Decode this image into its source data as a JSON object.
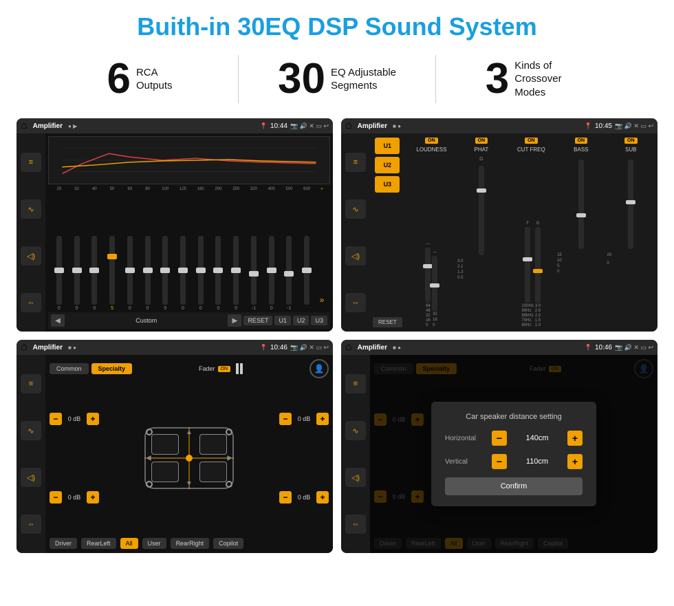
{
  "page": {
    "title": "Buith-in 30EQ DSP Sound System",
    "stats": [
      {
        "number": "6",
        "label_line1": "RCA",
        "label_line2": "Outputs"
      },
      {
        "number": "30",
        "label_line1": "EQ Adjustable",
        "label_line2": "Segments"
      },
      {
        "number": "3",
        "label_line1": "Kinds of",
        "label_line2": "Crossover Modes"
      }
    ]
  },
  "screen1": {
    "status_bar": {
      "app": "Amplifier",
      "time": "10:44"
    },
    "eq_bands": [
      "25",
      "32",
      "40",
      "50",
      "63",
      "80",
      "100",
      "125",
      "160",
      "200",
      "250",
      "320",
      "400",
      "500",
      "630"
    ],
    "eq_values": [
      "0",
      "0",
      "0",
      "5",
      "0",
      "0",
      "0",
      "0",
      "0",
      "0",
      "0",
      "-1",
      "0",
      "-1"
    ],
    "bottom_label": "Custom",
    "modes": [
      "RESET",
      "U1",
      "U2",
      "U3"
    ]
  },
  "screen2": {
    "status_bar": {
      "app": "Amplifier",
      "time": "10:45"
    },
    "presets": [
      "U1",
      "U2",
      "U3"
    ],
    "columns": [
      "LOUDNESS",
      "PHAT",
      "CUT FREQ",
      "BASS",
      "SUB"
    ],
    "reset_label": "RESET"
  },
  "screen3": {
    "status_bar": {
      "app": "Amplifier",
      "time": "10:46"
    },
    "tabs": [
      "Common",
      "Specialty"
    ],
    "active_tab": "Specialty",
    "fader_label": "Fader",
    "on_label": "ON",
    "db_values": [
      "0 dB",
      "0 dB",
      "0 dB",
      "0 dB"
    ],
    "zone_buttons": [
      "Driver",
      "RearLeft",
      "All",
      "User",
      "RearRight",
      "Copilot"
    ]
  },
  "screen4": {
    "status_bar": {
      "app": "Amplifier",
      "time": "10:46"
    },
    "tabs": [
      "Common",
      "Specialty"
    ],
    "active_tab": "Specialty",
    "dialog": {
      "title": "Car speaker distance setting",
      "horizontal_label": "Horizontal",
      "horizontal_value": "140cm",
      "vertical_label": "Vertical",
      "vertical_value": "110cm",
      "confirm_label": "Confirm"
    },
    "db_values": [
      "0 dB",
      "0 dB"
    ],
    "zone_buttons": [
      "Driver",
      "RearLeft",
      "All",
      "User",
      "RearRight",
      "Copilot"
    ]
  },
  "icons": {
    "home": "⌂",
    "back": "↩",
    "eq_icon": "⚡",
    "wave_icon": "∿",
    "volume_icon": "◁)",
    "expand_icon": "⇔",
    "play": "▶",
    "prev": "◀",
    "next": "▶▶"
  }
}
